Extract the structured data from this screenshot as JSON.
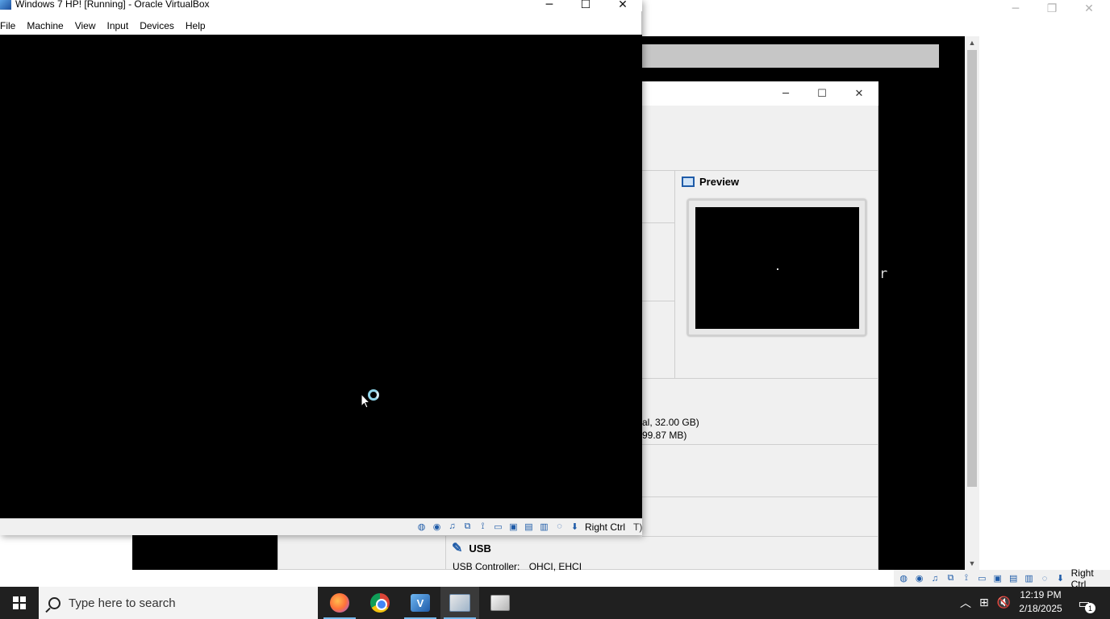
{
  "vbox_window": {
    "title": "Windows 7 HP! [Running] - Oracle VirtualBox",
    "menu": [
      "File",
      "Machine",
      "View",
      "Input",
      "Devices",
      "Help"
    ],
    "host_key_label": "Right Ctrl",
    "status_icons": [
      "hard-disk-icon",
      "optical-drive-icon",
      "audio-icon",
      "network-icon",
      "usb-icon",
      "shared-folders-icon",
      "display-icon",
      "recording-icon",
      "cpu-icon",
      "mouse-integration-icon",
      "keyboard-icon"
    ],
    "controls": {
      "minimize": "─",
      "maximize": "☐",
      "close": "✕"
    }
  },
  "manager_window": {
    "controls": {
      "minimize": "─",
      "maximize": "☐",
      "close": "✕"
    },
    "preview_title": "Preview",
    "storage_line1": "al, 32.00 GB)",
    "storage_line2": "99.87 MB)",
    "usb_title": "USB",
    "usb_controller_label": "USB Controller:",
    "usb_controller_value": "OHCI, EHCI"
  },
  "background_window": {
    "console_char": "r",
    "host_key_label": "Right Ctrl",
    "status_trailing": "T)"
  },
  "taskbar": {
    "search_placeholder": "Type here to search",
    "apps": [
      "firefox-icon",
      "chrome-icon",
      "virtualbox-icon",
      "vm-window-icon",
      "vm-window-icon-2"
    ],
    "clock_time": "12:19 PM",
    "clock_date": "2/18/2025",
    "notification_count": "1"
  }
}
